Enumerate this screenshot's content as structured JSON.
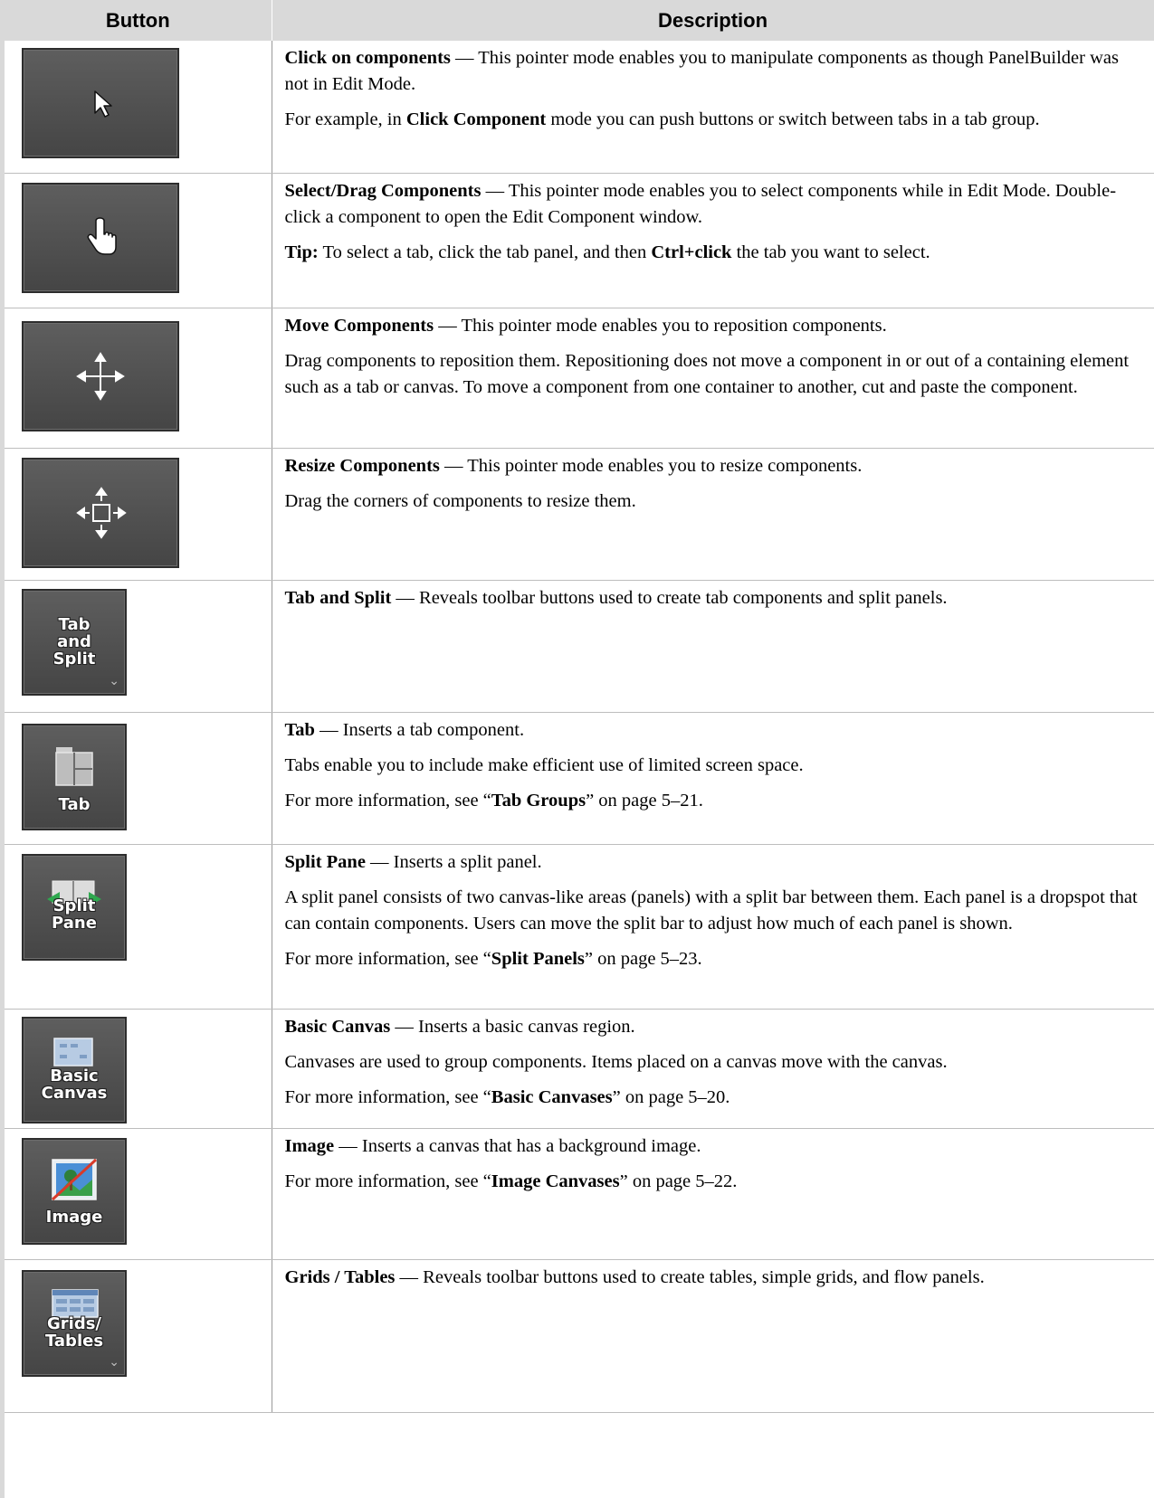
{
  "table": {
    "headers": {
      "button": "Button",
      "description": "Description"
    },
    "rows": [
      {
        "icon": "pointer-arrow-icon",
        "paragraphs": [
          [
            {
              "b": true,
              "t": "Click on components"
            },
            {
              "t": " — This pointer mode enables you to manipulate components as though PanelBuilder was not in Edit Mode."
            }
          ],
          [
            {
              "t": "For example, in "
            },
            {
              "b": true,
              "t": "Click Component"
            },
            {
              "t": " mode you can push buttons or switch between tabs in a tab group."
            }
          ]
        ]
      },
      {
        "icon": "hand-pointer-icon",
        "paragraphs": [
          [
            {
              "b": true,
              "t": "Select/Drag Components"
            },
            {
              "t": " — This pointer mode enables you to select components while in Edit Mode. Double-click a component to open the Edit Component window."
            }
          ],
          [
            {
              "b": true,
              "t": "Tip:"
            },
            {
              "t": " To select a tab, click the tab panel, and then "
            },
            {
              "b": true,
              "t": "Ctrl+click"
            },
            {
              "t": " the tab you want to select."
            }
          ]
        ]
      },
      {
        "icon": "move-arrows-icon",
        "paragraphs": [
          [
            {
              "b": true,
              "t": "Move Components"
            },
            {
              "t": " — This pointer mode enables you to reposition components."
            }
          ],
          [
            {
              "t": "Drag components to reposition them. Repositioning does not move a component in or out of a containing element such as a tab or canvas. To move a component from one container to another, cut and paste the component."
            }
          ]
        ]
      },
      {
        "icon": "resize-arrows-icon",
        "paragraphs": [
          [
            {
              "b": true,
              "t": "Resize Components"
            },
            {
              "t": " — This pointer mode enables you to resize components."
            }
          ],
          [
            {
              "t": "Drag the corners of components to resize them."
            }
          ]
        ]
      },
      {
        "icon": "tab-and-split-icon",
        "caption": [
          "Tab",
          "and",
          "Split"
        ],
        "paragraphs": [
          [
            {
              "b": true,
              "t": "Tab and Split"
            },
            {
              "t": " — Reveals toolbar buttons used to create tab components and split panels."
            }
          ]
        ]
      },
      {
        "icon": "tab-icon",
        "caption": [
          "Tab"
        ],
        "paragraphs": [
          [
            {
              "b": true,
              "t": "Tab"
            },
            {
              "t": " — Inserts a tab component."
            }
          ],
          [
            {
              "t": "Tabs enable you to include make efficient use of limited screen space."
            }
          ],
          [
            {
              "t": "For more information, see “"
            },
            {
              "b": true,
              "t": "Tab Groups"
            },
            {
              "t": "” on page 5–21."
            }
          ]
        ]
      },
      {
        "icon": "split-pane-icon",
        "caption": [
          "Split",
          "Pane"
        ],
        "paragraphs": [
          [
            {
              "b": true,
              "t": "Split Pane"
            },
            {
              "t": " — Inserts a split panel."
            }
          ],
          [
            {
              "t": "A split panel consists of two canvas-like areas (panels) with a split bar between them. Each panel is a dropspot that can contain components. Users can move the split bar to adjust how much of each panel is shown."
            }
          ],
          [
            {
              "t": "For more information, see “"
            },
            {
              "b": true,
              "t": "Split Panels"
            },
            {
              "t": "” on page 5–23."
            }
          ]
        ]
      },
      {
        "icon": "basic-canvas-icon",
        "caption": [
          "Basic",
          "Canvas"
        ],
        "paragraphs": [
          [
            {
              "b": true,
              "t": "Basic Canvas"
            },
            {
              "t": " — Inserts a basic canvas region."
            }
          ],
          [
            {
              "t": "Canvases are used to group components. Items placed on a canvas move with the canvas."
            }
          ],
          [
            {
              "t": "For more information, see “"
            },
            {
              "b": true,
              "t": "Basic Canvases"
            },
            {
              "t": "” on page 5–20."
            }
          ]
        ]
      },
      {
        "icon": "image-canvas-icon",
        "caption": [
          "Image"
        ],
        "paragraphs": [
          [
            {
              "b": true,
              "t": "Image"
            },
            {
              "t": " — Inserts a canvas that has a background image."
            }
          ],
          [
            {
              "t": "For more information, see “"
            },
            {
              "b": true,
              "t": "Image Canvases"
            },
            {
              "t": "” on page 5–22."
            }
          ]
        ]
      },
      {
        "icon": "grids-tables-icon",
        "caption": [
          "Grids/",
          "Tables"
        ],
        "paragraphs": [
          [
            {
              "b": true,
              "t": "Grids / Tables"
            },
            {
              "t": " — Reveals toolbar buttons used to create tables, simple grids, and flow panels."
            }
          ]
        ]
      }
    ]
  }
}
